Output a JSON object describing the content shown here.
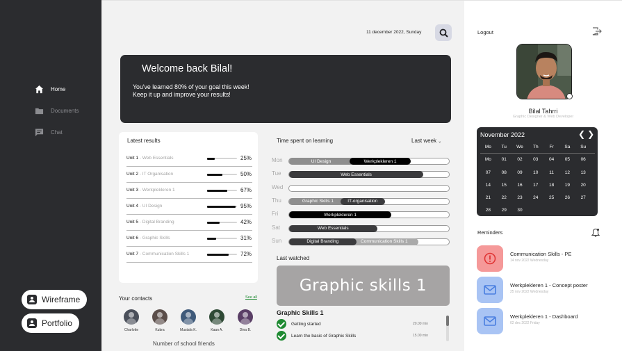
{
  "sidebar": {
    "items": [
      {
        "label": "Home",
        "icon": "home-icon",
        "active": true
      },
      {
        "label": "Documents",
        "icon": "folder-icon",
        "active": false
      },
      {
        "label": "Chat",
        "icon": "chat-icon",
        "active": false
      }
    ],
    "buttons": [
      {
        "label": "Wireframe",
        "icon": "contact-card-icon"
      },
      {
        "label": "Portfolio",
        "icon": "contact-card-icon"
      }
    ]
  },
  "header": {
    "date": "11 december 2022, Sunday",
    "search_icon": "search-icon"
  },
  "banner": {
    "welcome": "Welcome back Bilal!",
    "line1": "You've learned 80% of your goal this week!",
    "line2": "Keep it up and improve your results!"
  },
  "results": {
    "title": "Latest results",
    "rows": [
      {
        "unit": "Unit 1",
        "name": " - Web Essentials",
        "percent": "25%",
        "value": 0.25
      },
      {
        "unit": "Unit 2",
        "name": " - IT Organisation",
        "percent": "50%",
        "value": 0.5
      },
      {
        "unit": "Unit 3",
        "name": " - Werkplekleren 1",
        "percent": "67%",
        "value": 0.67
      },
      {
        "unit": "Unit 4",
        "name": " - UI Design",
        "percent": "95%",
        "value": 0.95
      },
      {
        "unit": "Unit 5",
        "name": " - Digital Branding",
        "percent": "42%",
        "value": 0.42
      },
      {
        "unit": "Unit 6",
        "name": " - Graphic Skills",
        "percent": "31%",
        "value": 0.31
      },
      {
        "unit": "Unit 7",
        "name": " - Communication Skills 1",
        "percent": "72%",
        "value": 0.72
      }
    ]
  },
  "time_spent": {
    "title": "Time spent on learning",
    "period_label": "Last week",
    "days": [
      {
        "day": "Mon",
        "segments": [
          {
            "label": "UI Design",
            "from": 0,
            "to": 0.4,
            "color": "#8e8e8e"
          },
          {
            "label": "Werkplekleren 1",
            "from": 0.38,
            "to": 0.76,
            "color": "#000000"
          }
        ]
      },
      {
        "day": "Tue",
        "segments": [
          {
            "label": "Web Essentials",
            "from": 0,
            "to": 0.84,
            "color": "#3b3b3d"
          }
        ]
      },
      {
        "day": "Wed",
        "segments": []
      },
      {
        "day": "Thu",
        "segments": [
          {
            "label": "Graphic Skills 1",
            "from": 0,
            "to": 0.36,
            "color": "#8e8e8e"
          },
          {
            "label": "IT-organisation",
            "from": 0.32,
            "to": 0.6,
            "color": "#3b3b3d"
          }
        ]
      },
      {
        "day": "Fri",
        "segments": [
          {
            "label": "Werkplekleren 1",
            "from": 0,
            "to": 0.64,
            "color": "#000000"
          }
        ]
      },
      {
        "day": "Sat",
        "segments": [
          {
            "label": "Web Essentials",
            "from": 0,
            "to": 0.55,
            "color": "#3b3b3d"
          }
        ]
      },
      {
        "day": "Sun",
        "segments": [
          {
            "label": "Communication Skills 1",
            "from": 0.38,
            "to": 0.81,
            "color": "#aaaaaa"
          },
          {
            "label": "Digital Branding",
            "from": 0,
            "to": 0.42,
            "color": "#3b3b3d"
          }
        ]
      }
    ]
  },
  "last_watched": {
    "title": "Last watched",
    "thumbnail_text": "Graphic skills 1",
    "course": "Graphic Skills 1",
    "lessons": [
      {
        "title": "Getting started",
        "duration": "20.00 min"
      },
      {
        "title": "Learn the basic of Graphic Skills",
        "duration": "15.00 min"
      }
    ]
  },
  "contacts": {
    "title": "Your contacts",
    "see_all": "See all",
    "people": [
      {
        "name": "Charlotte",
        "color": "#4a4f5a"
      },
      {
        "name": "Kubra",
        "color": "#5b4e4a"
      },
      {
        "name": "Mustafa K.",
        "color": "#3f5a7a"
      },
      {
        "name": "Kaan A.",
        "color": "#2f4a36"
      },
      {
        "name": "Dina B.",
        "color": "#5a3f66"
      }
    ],
    "caption": "Number of school friends"
  },
  "profile": {
    "logout": "Logout",
    "name": "Bilal Tahrri",
    "role": "Graphic Designer & Web Developer"
  },
  "calendar": {
    "month": "November 2022",
    "weekdays": [
      "Mo",
      "Tu",
      "We",
      "Th",
      "Fr",
      "Sa",
      "Su"
    ],
    "days": [
      "Mo",
      "01",
      "02",
      "03",
      "04",
      "05",
      "06",
      "07",
      "08",
      "09",
      "10",
      "11",
      "12",
      "13",
      "14",
      "15",
      "16",
      "17",
      "18",
      "19",
      "20",
      "21",
      "22",
      "23",
      "24",
      "25",
      "26",
      "27",
      "28",
      "29",
      "30"
    ]
  },
  "reminders": {
    "title": "Reminders",
    "items": [
      {
        "title": "Communication Skills - PE",
        "date": "14 nov 2022 Wednesday",
        "type": "alert",
        "bg": "#f59999",
        "fg": "#e03535"
      },
      {
        "title": "Werkplekleren 1 - Concept poster",
        "date": "25 nov 2022 Wednesday",
        "type": "mail",
        "bg": "#a9c4f4",
        "fg": "#4a7fe0"
      },
      {
        "title": "Werkplekleren 1 - Dashboard",
        "date": "02 dec 2022 Friday",
        "type": "mail",
        "bg": "#a9c4f4",
        "fg": "#4a7fe0"
      }
    ]
  }
}
